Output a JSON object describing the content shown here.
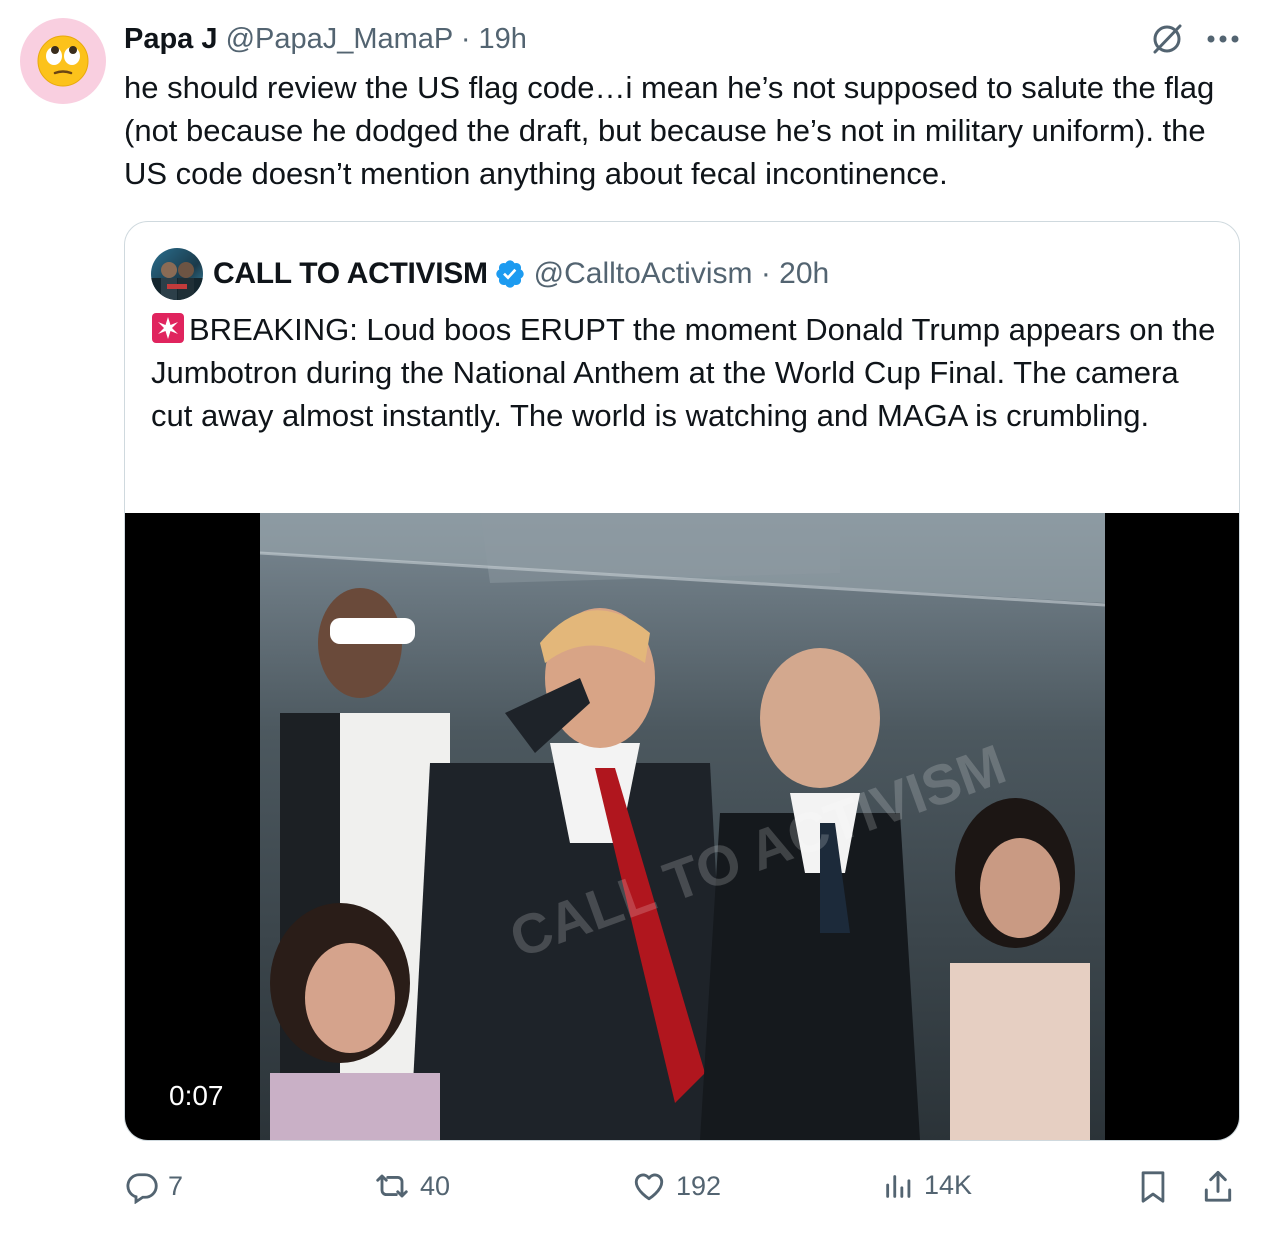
{
  "author": {
    "name": "Papa J",
    "handle": "@PapaJ_MamaP",
    "time": "19h",
    "avatar_emoji": "face-with-rolling-eyes"
  },
  "tweet": {
    "text": "he should review the US flag code…i mean he’s not supposed to salute the flag (not because he dodged the draft, but because he’s not in military uniform). the US code doesn’t mention anything about fecal incontinence."
  },
  "quote": {
    "name": "CALL TO ACTIVISM",
    "verified": true,
    "handle": "@CalltoActivism",
    "time": "20h",
    "text": "BREAKING: Loud boos ERUPT the moment Donald Trump appears on the Jumbotron during the National Anthem at the World Cup Final. The camera cut away almost instantly. The world is watching and MAGA is crumbling.",
    "video": {
      "duration": "0:07",
      "watermark": "CALL TO ACTIVISM"
    }
  },
  "actions": {
    "replies": "7",
    "reposts": "40",
    "likes": "192",
    "views": "14K"
  },
  "colors": {
    "text": "#0f1419",
    "secondary": "#536471",
    "verified": "#1d9bf0",
    "avatar_bg": "#f9cfe0",
    "border": "#cfd9de"
  }
}
